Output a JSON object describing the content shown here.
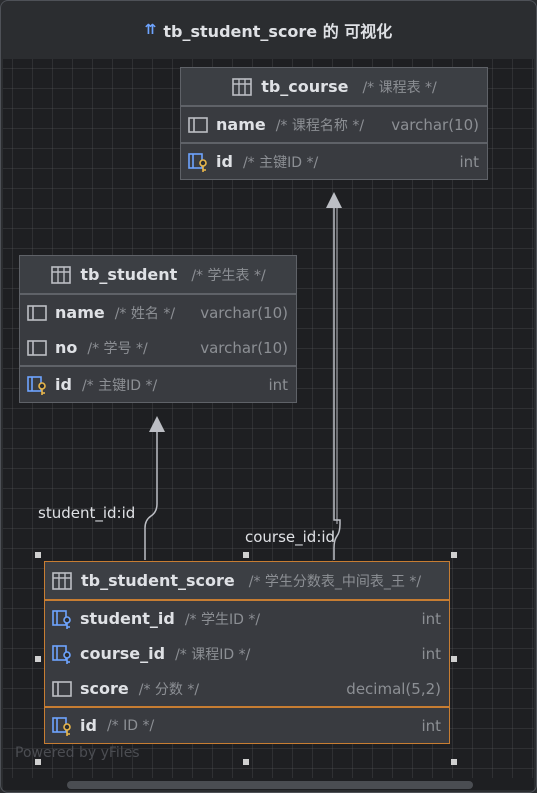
{
  "window": {
    "title": "tb_student_score 的 可视化"
  },
  "watermark": "Powered by yFiles",
  "tables": {
    "tb_course": {
      "name": "tb_course",
      "comment": "/* 课程表 */",
      "columns": [
        {
          "name": "name",
          "comment": "/* 课程名称 */",
          "type": "varchar(10)",
          "icon": "column-icon"
        }
      ],
      "key": {
        "name": "id",
        "comment": "/* 主键ID */",
        "type": "int",
        "icon": "primary-key-icon"
      }
    },
    "tb_student": {
      "name": "tb_student",
      "comment": "/* 学生表 */",
      "columns": [
        {
          "name": "name",
          "comment": "/* 姓名 */",
          "type": "varchar(10)",
          "icon": "column-icon"
        },
        {
          "name": "no",
          "comment": "/* 学号 */",
          "type": "varchar(10)",
          "icon": "column-icon"
        }
      ],
      "key": {
        "name": "id",
        "comment": "/* 主键ID */",
        "type": "int",
        "icon": "primary-key-icon"
      }
    },
    "tb_student_score": {
      "name": "tb_student_score",
      "comment": "/* 学生分数表_中间表_王 */",
      "columns": [
        {
          "name": "student_id",
          "comment": "/* 学生ID */",
          "type": "int",
          "icon": "foreign-key-icon"
        },
        {
          "name": "course_id",
          "comment": "/* 课程ID */",
          "type": "int",
          "icon": "foreign-key-icon"
        },
        {
          "name": "score",
          "comment": "/* 分数 */",
          "type": "decimal(5,2)",
          "icon": "column-icon"
        }
      ],
      "key": {
        "name": "id",
        "comment": "/* ID */",
        "type": "int",
        "icon": "primary-key-icon"
      }
    }
  },
  "edges": {
    "student": {
      "label": "student_id:id"
    },
    "course": {
      "label": "course_id:id"
    }
  },
  "colors": {
    "canvas": "#1e1f22",
    "selection": "#c77d32",
    "accent": "#6ea4ff",
    "key": "#e8b64a"
  }
}
